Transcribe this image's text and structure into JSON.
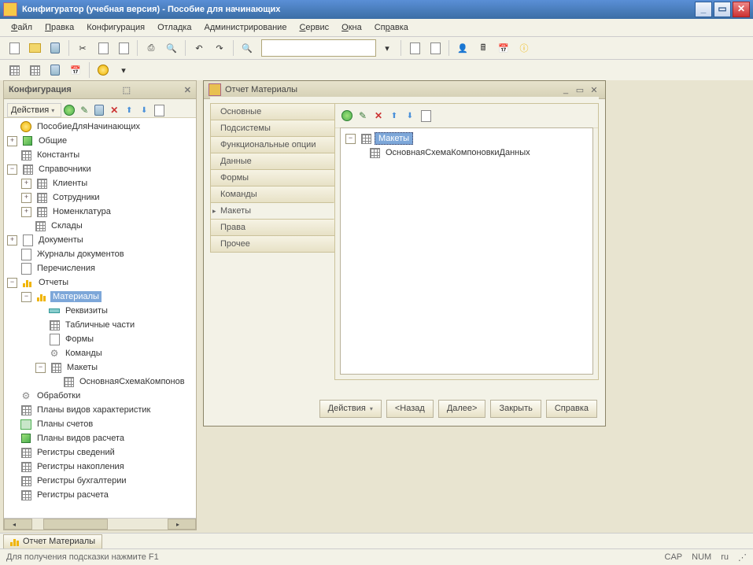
{
  "titlebar": {
    "text": "Конфигуратор (учебная версия) - Пособие для начинающих"
  },
  "menu": {
    "file": "Файл",
    "edit": "Правка",
    "config": "Конфигурация",
    "debug": "Отладка",
    "admin": "Администрирование",
    "service": "Сервис",
    "windows": "Окна",
    "help": "Справка"
  },
  "cfg": {
    "title": "Конфигурация",
    "actions": "Действия",
    "tree": [
      {
        "d": 0,
        "exp": "",
        "icon": "circle-y",
        "label": "ПособиеДляНачинающих"
      },
      {
        "d": 0,
        "exp": "+",
        "icon": "cube",
        "label": "Общие"
      },
      {
        "d": 0,
        "exp": "",
        "icon": "grid",
        "label": "Константы"
      },
      {
        "d": 0,
        "exp": "-",
        "icon": "grid",
        "label": "Справочники"
      },
      {
        "d": 1,
        "exp": "+",
        "icon": "grid",
        "label": "Клиенты"
      },
      {
        "d": 1,
        "exp": "+",
        "icon": "grid",
        "label": "Сотрудники"
      },
      {
        "d": 1,
        "exp": "+",
        "icon": "grid",
        "label": "Номенклатура"
      },
      {
        "d": 1,
        "exp": "",
        "icon": "grid",
        "label": "Склады"
      },
      {
        "d": 0,
        "exp": "+",
        "icon": "doc",
        "label": "Документы"
      },
      {
        "d": 0,
        "exp": "",
        "icon": "doc",
        "label": "Журналы документов"
      },
      {
        "d": 0,
        "exp": "",
        "icon": "doc",
        "label": "Перечисления"
      },
      {
        "d": 0,
        "exp": "-",
        "icon": "bar",
        "label": "Отчеты"
      },
      {
        "d": 1,
        "exp": "-",
        "icon": "bar",
        "label": "Материалы",
        "sel": true
      },
      {
        "d": 2,
        "exp": "",
        "icon": "attr",
        "label": "Реквизиты"
      },
      {
        "d": 2,
        "exp": "",
        "icon": "grid",
        "label": "Табличные части"
      },
      {
        "d": 2,
        "exp": "",
        "icon": "doc",
        "label": "Формы"
      },
      {
        "d": 2,
        "exp": "",
        "icon": "gear",
        "label": "Команды"
      },
      {
        "d": 2,
        "exp": "-",
        "icon": "grid",
        "label": "Макеты"
      },
      {
        "d": 3,
        "exp": "",
        "icon": "grid",
        "label": "ОсновнаяСхемаКомпонов"
      },
      {
        "d": 0,
        "exp": "",
        "icon": "gear",
        "label": "Обработки"
      },
      {
        "d": 0,
        "exp": "",
        "icon": "grid",
        "label": "Планы видов характеристик"
      },
      {
        "d": 0,
        "exp": "",
        "icon": "book",
        "label": "Планы счетов"
      },
      {
        "d": 0,
        "exp": "",
        "icon": "cube",
        "label": "Планы видов расчета"
      },
      {
        "d": 0,
        "exp": "",
        "icon": "grid",
        "label": "Регистры сведений"
      },
      {
        "d": 0,
        "exp": "",
        "icon": "grid",
        "label": "Регистры накопления"
      },
      {
        "d": 0,
        "exp": "",
        "icon": "grid",
        "label": "Регистры бухгалтерии"
      },
      {
        "d": 0,
        "exp": "",
        "icon": "grid",
        "label": "Регистры расчета"
      }
    ]
  },
  "report": {
    "title": "Отчет Материалы",
    "tabs": [
      "Основные",
      "Подсистемы",
      "Функциональные опции",
      "Данные",
      "Формы",
      "Команды",
      "Макеты",
      "Права",
      "Прочее"
    ],
    "active_tab": 6,
    "tree_root": "Макеты",
    "tree_item": "ОсновнаяСхемаКомпоновкиДанных",
    "buttons": {
      "actions": "Действия",
      "back": "<Назад",
      "next": "Далее>",
      "close": "Закрыть",
      "help": "Справка"
    }
  },
  "taskbar": {
    "item": "Отчет Материалы"
  },
  "status": {
    "hint": "Для получения подсказки нажмите F1",
    "cap": "CAP",
    "num": "NUM",
    "lang": "ru"
  }
}
